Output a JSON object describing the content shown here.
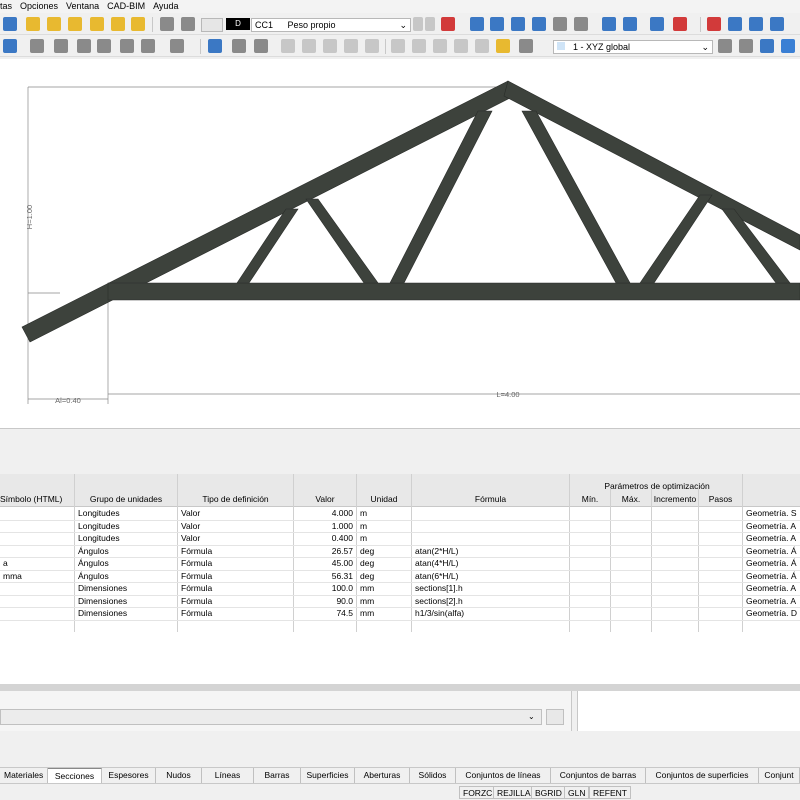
{
  "menu": [
    "tas",
    "Opciones",
    "Ventana",
    "CAD-BIM",
    "Ayuda"
  ],
  "toolbar": {
    "load_case_letter": "D",
    "load_case_id": "CC1",
    "load_case_name": "Peso propio",
    "coord_system": "1 - XYZ global"
  },
  "drawing": {
    "dim_h": "H=1.00",
    "dim_al": "Al=0.40",
    "dim_l": "L=4.00"
  },
  "table": {
    "group_header": "Parámetros de optimización",
    "columns": [
      "Símbolo (HTML)",
      "Grupo de unidades",
      "Tipo de definición",
      "Valor",
      "Unidad",
      "Fórmula",
      "Mín.",
      "Máx.",
      "Incremento",
      "Pasos",
      ""
    ],
    "rows": [
      {
        "symbol": "",
        "group": "Longitudes",
        "deftype": "Valor",
        "value": "4.000",
        "unit": "m",
        "formula": "",
        "comment": "Geometría. S"
      },
      {
        "symbol": "",
        "group": "Longitudes",
        "deftype": "Valor",
        "value": "1.000",
        "unit": "m",
        "formula": "",
        "comment": "Geometría. A"
      },
      {
        "symbol": "",
        "group": "Longitudes",
        "deftype": "Valor",
        "value": "0.400",
        "unit": "m",
        "formula": "",
        "comment": "Geometría. A"
      },
      {
        "symbol": "",
        "group": "Ángulos",
        "deftype": "Fórmula",
        "value": "26.57",
        "unit": "deg",
        "formula": "atan(2*H/L)",
        "comment": "Geometría. Á"
      },
      {
        "symbol": "a",
        "group": "Ángulos",
        "deftype": "Fórmula",
        "value": "45.00",
        "unit": "deg",
        "formula": "atan(4*H/L)",
        "comment": "Geometría. Á"
      },
      {
        "symbol": "mma",
        "group": "Ángulos",
        "deftype": "Fórmula",
        "value": "56.31",
        "unit": "deg",
        "formula": "atan(6*H/L)",
        "comment": "Geometría. Á"
      },
      {
        "symbol": "",
        "group": "Dimensiones",
        "deftype": "Fórmula",
        "value": "100.0",
        "unit": "mm",
        "formula": "sections[1].h",
        "comment": "Geometría. A"
      },
      {
        "symbol": "",
        "group": "Dimensiones",
        "deftype": "Fórmula",
        "value": "90.0",
        "unit": "mm",
        "formula": "sections[2].h",
        "comment": "Geometría. A"
      },
      {
        "symbol": "",
        "group": "Dimensiones",
        "deftype": "Fórmula",
        "value": "74.5",
        "unit": "mm",
        "formula": "h1/3/sin(alfa)",
        "comment": "Geometría. D"
      }
    ]
  },
  "tabs": [
    "Materiales",
    "Secciones",
    "Espesores",
    "Nudos",
    "Líneas",
    "Barras",
    "Superficies",
    "Aberturas",
    "Sólidos",
    "Conjuntos de líneas",
    "Conjuntos de barras",
    "Conjuntos de superficies",
    "Conjunt"
  ],
  "active_tab": "Secciones",
  "status": [
    "FORZC",
    "REJILLA",
    "BGRID",
    "GLN",
    "REFENT"
  ]
}
